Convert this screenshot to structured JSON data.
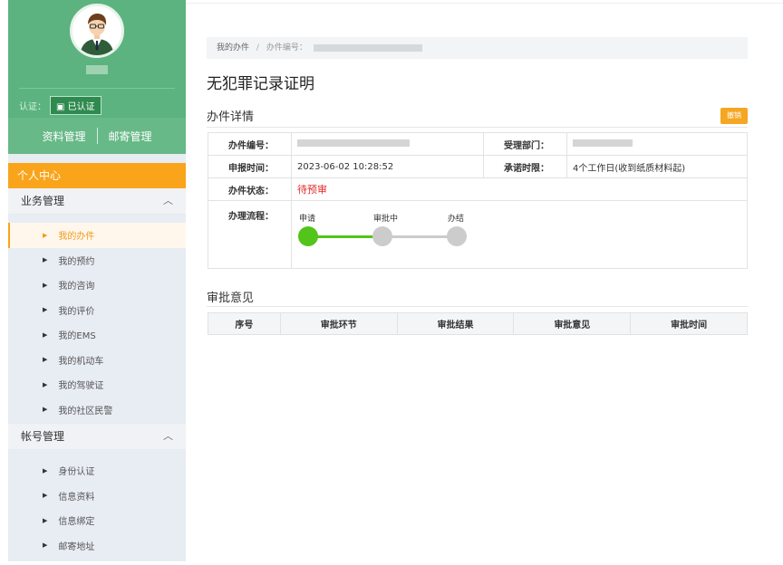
{
  "sidebar": {
    "auth_label": "认证：",
    "auth_badge": "已认证",
    "profile_links": [
      "资料管理",
      "邮寄管理"
    ],
    "center_header": "个人中心",
    "groups": [
      {
        "title": "业务管理",
        "items": [
          "我的办件",
          "我的预约",
          "我的咨询",
          "我的评价",
          "我的EMS",
          "我的机动车",
          "我的驾驶证",
          "我的社区民警"
        ]
      },
      {
        "title": "帐号管理",
        "items": [
          "身份认证",
          "信息资料",
          "信息绑定",
          "邮寄地址"
        ]
      }
    ],
    "active_item": "我的办件"
  },
  "breadcrumb": {
    "home": "我的办件",
    "sep": "/",
    "current": "办件编号："
  },
  "page_title": "无犯罪记录证明",
  "details": {
    "section_title": "办件详情",
    "cancel_label": "撤销",
    "labels": {
      "id": "办件编号：",
      "dept": "受理部门：",
      "apply_time": "申报时间：",
      "promise": "承诺时限：",
      "status": "办件状态：",
      "process": "办理流程："
    },
    "apply_time": "2023-06-02 10:28:52",
    "promise": "4个工作日(收到纸质材料起)",
    "status": "待预审",
    "process_steps": [
      "申请",
      "审批中",
      "办结"
    ]
  },
  "approval": {
    "section_title": "审批意见",
    "columns": [
      "序号",
      "审批环节",
      "审批结果",
      "审批意见",
      "审批时间"
    ]
  },
  "colors": {
    "accent": "#f9a41b",
    "profile": "#5cb37f",
    "status": "#e02b2b",
    "flow_done": "#52c41a",
    "flow_pending": "#cccccc"
  }
}
